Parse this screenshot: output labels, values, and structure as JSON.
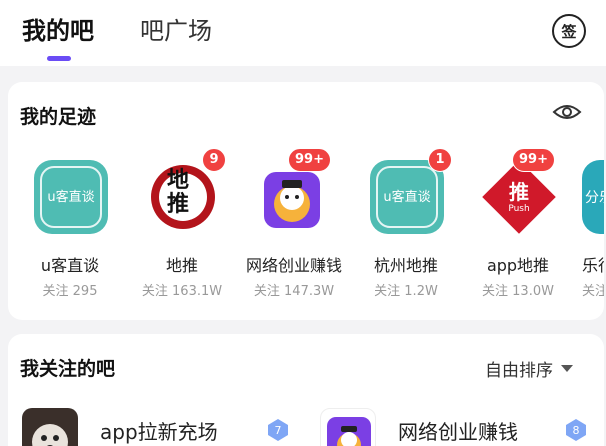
{
  "tabs": [
    {
      "label": "我的吧",
      "active": true
    },
    {
      "label": "吧广场",
      "active": false
    }
  ],
  "sign_button": {
    "label": "签"
  },
  "footprint": {
    "title": "我的足迹",
    "items": [
      {
        "name": "u客直谈",
        "followers": "关注 295",
        "badge": "",
        "icon_text": "u客直谈"
      },
      {
        "name": "地推",
        "followers": "关注 163.1W",
        "badge": "9",
        "icon_text": "地推"
      },
      {
        "name": "网络创业赚钱",
        "followers": "关注 147.3W",
        "badge": "99+",
        "icon_text": ""
      },
      {
        "name": "杭州地推",
        "followers": "关注 1.2W",
        "badge": "1",
        "icon_text": "u客直谈"
      },
      {
        "name": "app地推",
        "followers": "关注 13.0W",
        "badge": "99+",
        "icon_text": "推"
      },
      {
        "name": "乐行",
        "followers": "关注",
        "badge": "",
        "icon_text": "分乐"
      }
    ]
  },
  "followed": {
    "title": "我关注的吧",
    "sort_label": "自由排序",
    "items": [
      {
        "name": "app拉新充场",
        "level": "7"
      },
      {
        "name": "网络创业赚钱",
        "level": "8"
      }
    ]
  },
  "colors": {
    "accent": "#6a4cf5",
    "badge": "#f04140",
    "teal": "#4fbcb3",
    "level": "#7fa6f5"
  }
}
